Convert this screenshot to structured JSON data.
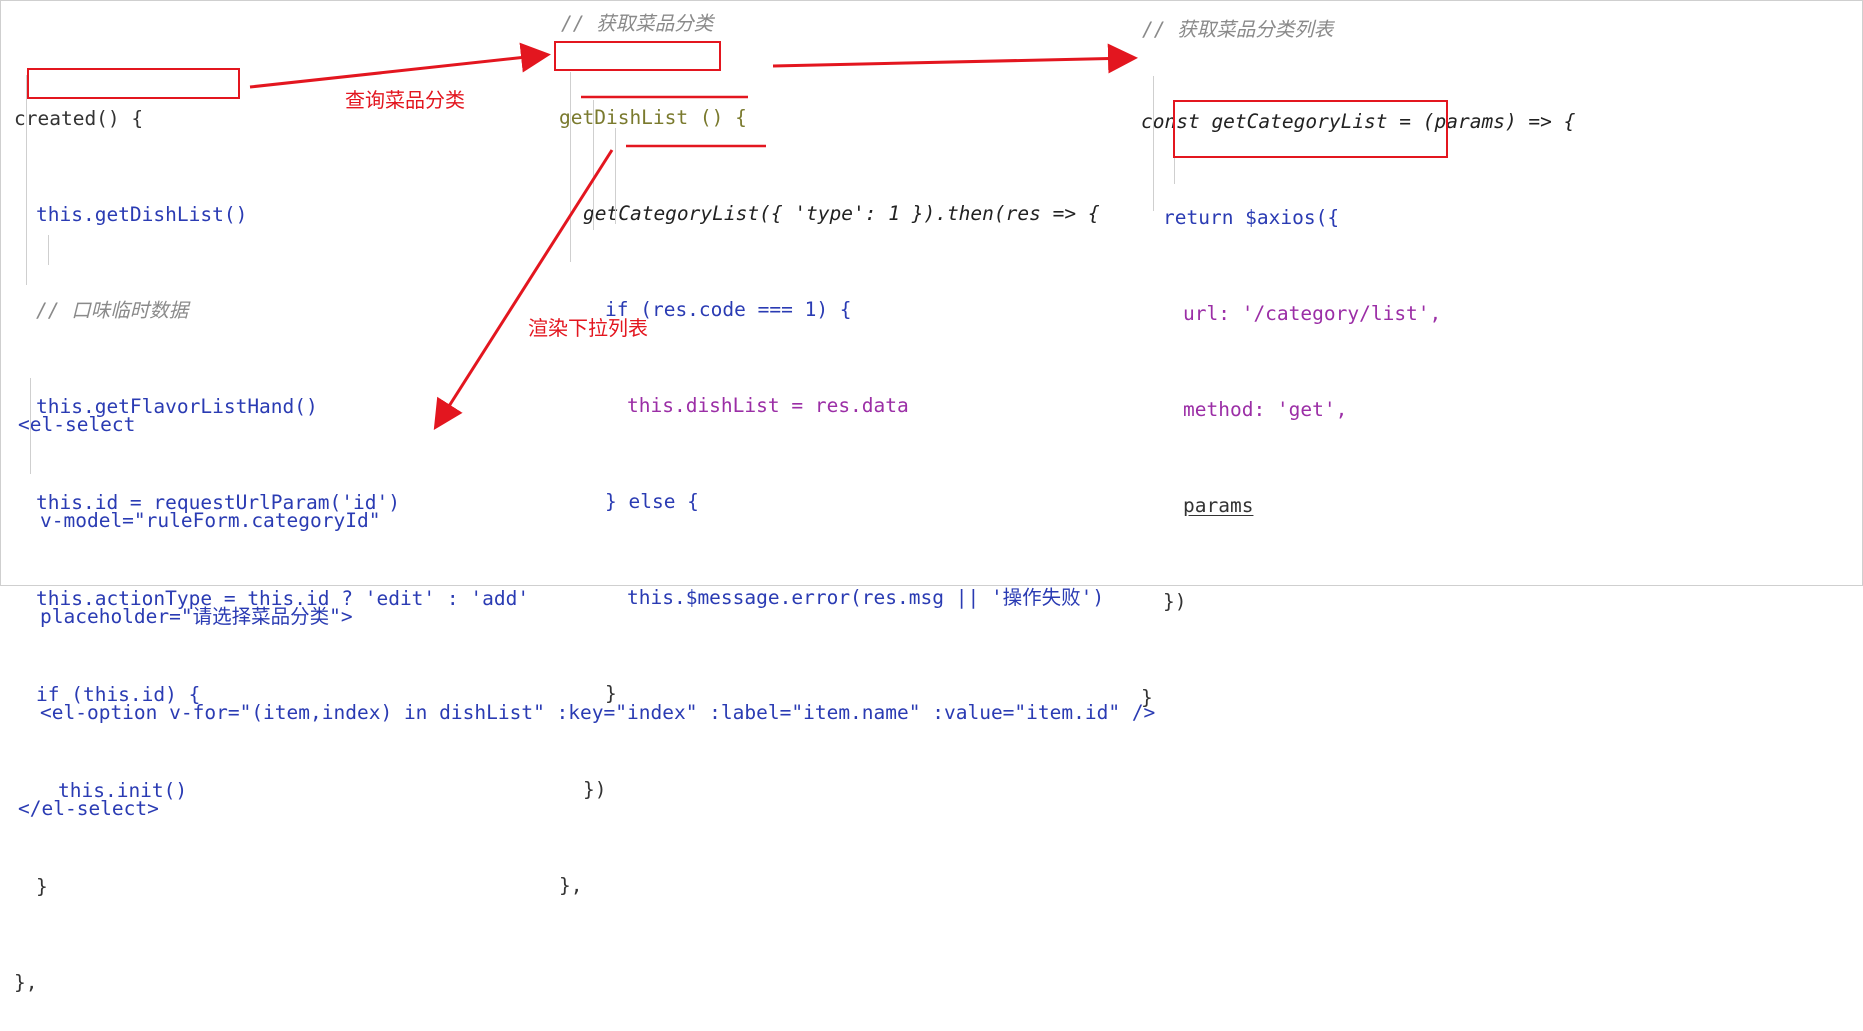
{
  "annotations": {
    "query_label": "查询菜品分类",
    "render_label": "渲染下拉列表"
  },
  "left": [
    "created() {",
    "this.getDishList()",
    "// 口味临时数据",
    "this.getFlavorListHand()",
    "this.id = requestUrlParam('id')",
    "this.actionType = this.id ? 'edit' : 'add'",
    "if (this.id) {",
    "this.init()",
    "}",
    "},"
  ],
  "middle": {
    "comment": "// 获取菜品分类",
    "lines": [
      "getDishList () {",
      "getCategoryList({ 'type': 1 }).then(res => {",
      "if (res.code === 1) {",
      "this.dishList = res.data",
      "} else {",
      "this.$message.error(res.msg || '操作失败')",
      "}",
      "})",
      "},"
    ]
  },
  "right": {
    "comment": "// 获取菜品分类列表",
    "lines": [
      "const getCategoryList = (params) => {",
      "return $axios({",
      "url: '/category/list',",
      "method: 'get',",
      "params",
      "})",
      "}"
    ]
  },
  "bottom": [
    "<el-select",
    "v-model=\"ruleForm.categoryId\"",
    "placeholder=\"请选择菜品分类\">",
    "<el-option v-for=\"(item,index) in dishList\" :key=\"index\" :label=\"item.name\" :value=\"item.id\" />",
    "</el-select>"
  ],
  "colors": {
    "accent_red": "#e3161f",
    "keyword": "#2a3bb3",
    "string": "#177a17",
    "comment": "#8a8a8a",
    "property": "#9b2ea6"
  }
}
